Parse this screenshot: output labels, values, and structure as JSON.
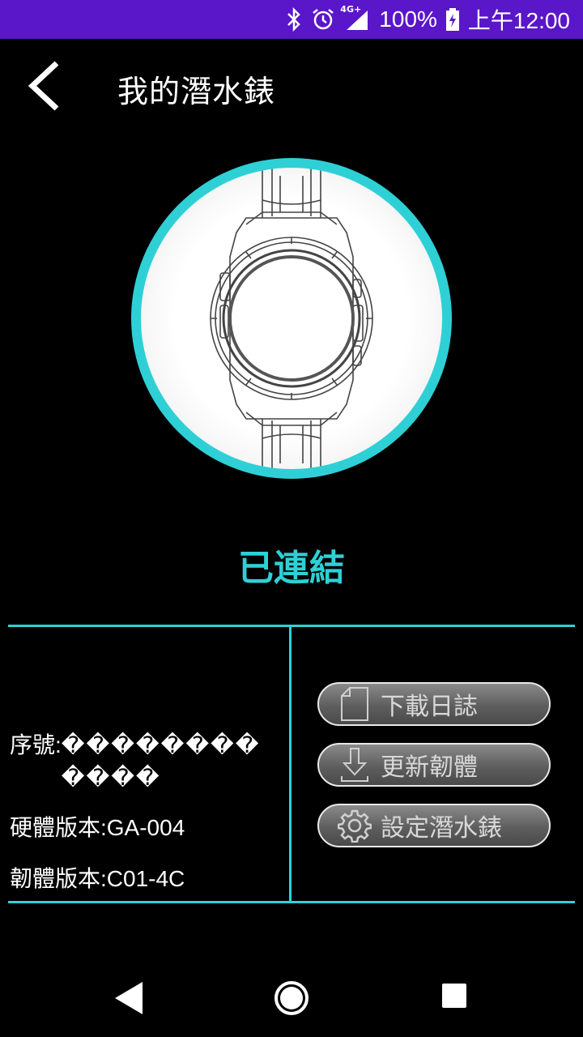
{
  "status_bar": {
    "network": "4G+",
    "battery": "100%",
    "time": "上午12:00"
  },
  "header": {
    "title": "我的潛水錶",
    "back_icon": "chevron-left-icon"
  },
  "device": {
    "connection_status": "已連結",
    "serial_label": "序號:",
    "serial_value": "������������",
    "hardware_version": "硬體版本:GA-004",
    "firmware_version": "韌體版本:C01-4C"
  },
  "actions": [
    {
      "label": "下載日誌",
      "icon": "document-icon"
    },
    {
      "label": "更新韌體",
      "icon": "download-icon"
    },
    {
      "label": "設定潛水錶",
      "icon": "gear-icon"
    }
  ],
  "colors": {
    "accent": "#2ed0d6",
    "status_bar": "#5a16c9",
    "background": "#000000",
    "button": "#5e5e5e"
  }
}
